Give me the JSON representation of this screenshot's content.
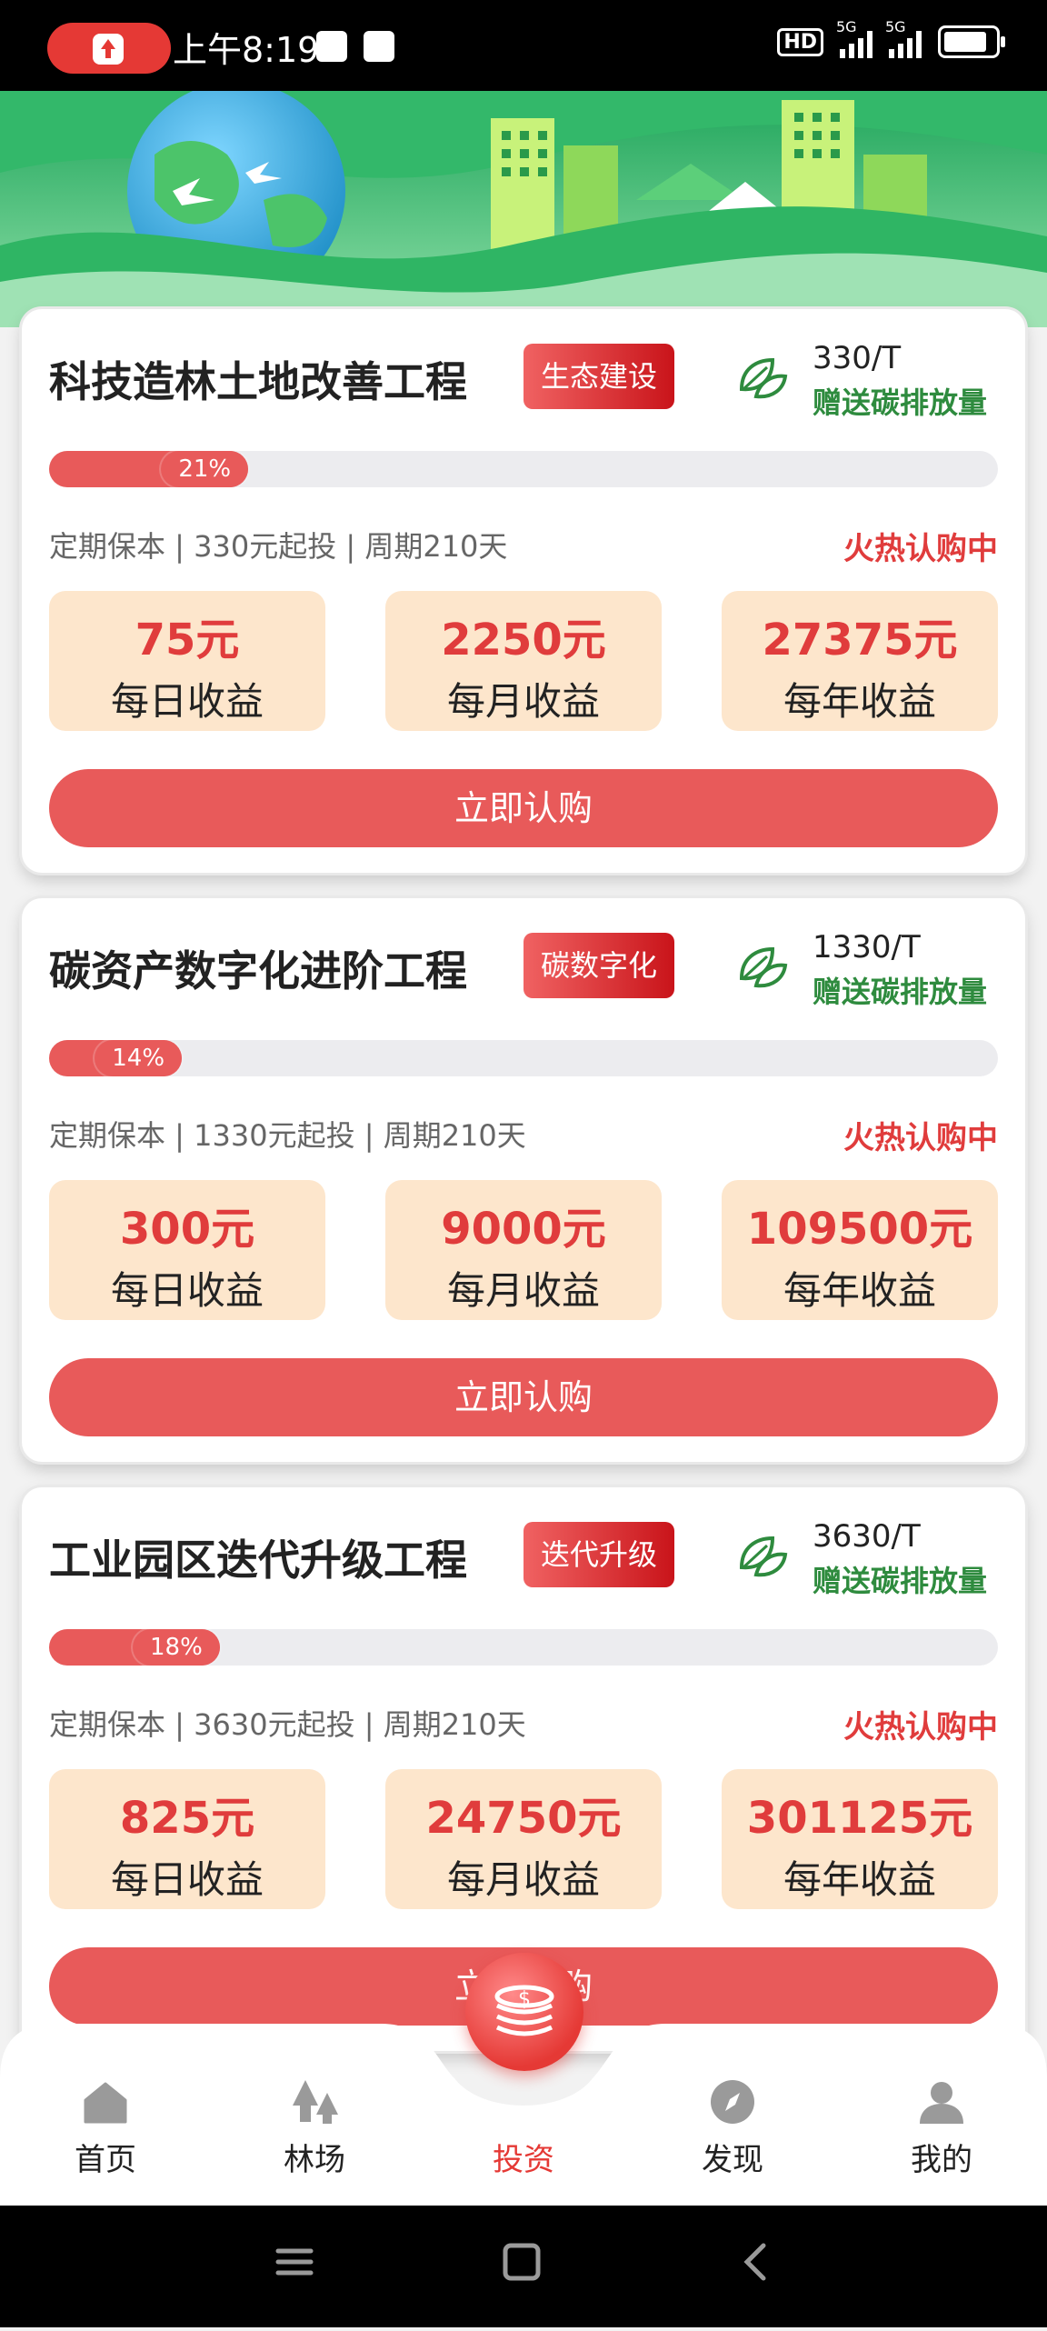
{
  "status_bar": {
    "time": "上午8:19",
    "network_1": "5G",
    "network_2": "5G",
    "hd": "HD"
  },
  "cards": [
    {
      "title": "科技造林土地改善工程",
      "tag": "生态建设",
      "carbon_amount": "330/T",
      "carbon_label": "赠送碳排放量",
      "progress_label": "21%",
      "progress": 0.21,
      "terms": "定期保本 | 330元起投 | 周期210天",
      "status": "火热认购中",
      "earnings": [
        {
          "value": "75元",
          "label": "每日收益"
        },
        {
          "value": "2250元",
          "label": "每月收益"
        },
        {
          "value": "27375元",
          "label": "每年收益"
        }
      ],
      "button": "立即认购"
    },
    {
      "title": "碳资产数字化进阶工程",
      "tag": "碳数字化",
      "carbon_amount": "1330/T",
      "carbon_label": "赠送碳排放量",
      "progress_label": "14%",
      "progress": 0.14,
      "terms": "定期保本 | 1330元起投 | 周期210天",
      "status": "火热认购中",
      "earnings": [
        {
          "value": "300元",
          "label": "每日收益"
        },
        {
          "value": "9000元",
          "label": "每月收益"
        },
        {
          "value": "109500元",
          "label": "每年收益"
        }
      ],
      "button": "立即认购"
    },
    {
      "title": "工业园区迭代升级工程",
      "tag": "迭代升级",
      "carbon_amount": "3630/T",
      "carbon_label": "赠送碳排放量",
      "progress_label": "18%",
      "progress": 0.18,
      "terms": "定期保本 | 3630元起投 | 周期210天",
      "status": "火热认购中",
      "earnings": [
        {
          "value": "825元",
          "label": "每日收益"
        },
        {
          "value": "24750元",
          "label": "每月收益"
        },
        {
          "value": "301125元",
          "label": "每年收益"
        }
      ],
      "button": "立即认购"
    }
  ],
  "nav": {
    "items": [
      {
        "label": "首页",
        "icon": "home-icon"
      },
      {
        "label": "林场",
        "icon": "trees-icon"
      },
      {
        "label": "投资",
        "icon": "coins-icon",
        "active": true
      },
      {
        "label": "发现",
        "icon": "compass-icon"
      },
      {
        "label": "我的",
        "icon": "user-icon"
      }
    ]
  },
  "colors": {
    "accent": "#e85a5a",
    "tag_gradient_end": "#c9141a",
    "earn_bg": "#fde6cc",
    "carbon_green": "#2e8b3e",
    "active_nav": "#e53935"
  }
}
